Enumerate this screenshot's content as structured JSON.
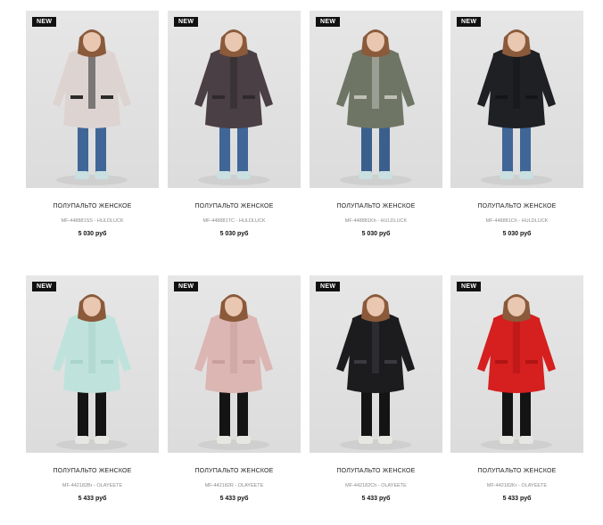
{
  "products": [
    {
      "badge": "NEW",
      "title": "ПОЛУПАЛЬТО ЖЕНСКОЕ",
      "sku": "MF-448881SS - HULDLUCK",
      "price": "5 030 руб",
      "jacket_color": "#ddd4d2",
      "accent": "#2a2a2a"
    },
    {
      "badge": "NEW",
      "title": "ПОЛУПАЛЬТО ЖЕНСКОЕ",
      "sku": "MF-448881TC - HULDLUCK",
      "price": "5 030 руб",
      "jacket_color": "#4a3f44",
      "accent": "#2e2a2c"
    },
    {
      "badge": "NEW",
      "title": "ПОЛУПАЛЬТО ЖЕНСКОЕ",
      "sku": "MF-448881Kh - HULDLUCK",
      "price": "5 030 руб",
      "jacket_color": "#6f7565",
      "accent": "#bfbfb8"
    },
    {
      "badge": "NEW",
      "title": "ПОЛУПАЛЬТО ЖЕНСКОЕ",
      "sku": "MF-448881Ch - HULDLUCK",
      "price": "5 030 руб",
      "jacket_color": "#1f2024",
      "accent": "#141518"
    },
    {
      "badge": "NEW",
      "title": "ПОЛУПАЛЬТО ЖЕНСКОЕ",
      "sku": "MF-442182Br - OLAYEETE",
      "price": "5 433 руб",
      "jacket_color": "#bfe3dc",
      "accent": "#a8d4cc"
    },
    {
      "badge": "NEW",
      "title": "ПОЛУПАЛЬТО ЖЕНСКОЕ",
      "sku": "MF-442182R - OLAYEETE",
      "price": "5 433 руб",
      "jacket_color": "#dcb6b3",
      "accent": "#c99f9c"
    },
    {
      "badge": "NEW",
      "title": "ПОЛУПАЛЬТО ЖЕНСКОЕ",
      "sku": "MF-442182Ch - OLAYEETE",
      "price": "5 433 руб",
      "jacket_color": "#1c1c1f",
      "accent": "#3a3a40"
    },
    {
      "badge": "NEW",
      "title": "ПОЛУПАЛЬТО ЖЕНСКОЕ",
      "sku": "MF-442182Kr - OLAYEETE",
      "price": "5 433 руб",
      "jacket_color": "#d61f1f",
      "accent": "#b01414"
    }
  ]
}
